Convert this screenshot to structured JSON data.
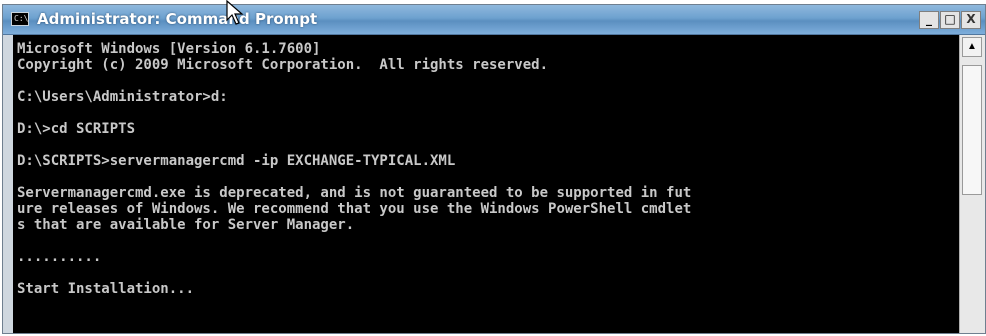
{
  "window": {
    "title": "Administrator: Command Prompt",
    "icon_label": "C:\\",
    "buttons": {
      "minimize": "_",
      "maximize": "□",
      "close": "X"
    }
  },
  "console": {
    "lines": [
      "Microsoft Windows [Version 6.1.7600]",
      "Copyright (c) 2009 Microsoft Corporation.  All rights reserved.",
      "",
      "C:\\Users\\Administrator>d:",
      "",
      "D:\\>cd SCRIPTS",
      "",
      "D:\\SCRIPTS>servermanagercmd -ip EXCHANGE-TYPICAL.XML",
      "",
      "Servermanagercmd.exe is deprecated, and is not guaranteed to be supported in fut",
      "ure releases of Windows. We recommend that you use the Windows PowerShell cmdlet",
      "s that are available for Server Manager.",
      "",
      "..........",
      "",
      "Start Installation..."
    ]
  },
  "scrollbar": {
    "up_arrow": "▲"
  },
  "icons": {
    "cursor": "mouse-pointer-icon",
    "app": "command-prompt-icon"
  },
  "colors": {
    "console_bg": "#000000",
    "console_text": "#c8c8c8",
    "titlebar": "#6da1cf"
  }
}
